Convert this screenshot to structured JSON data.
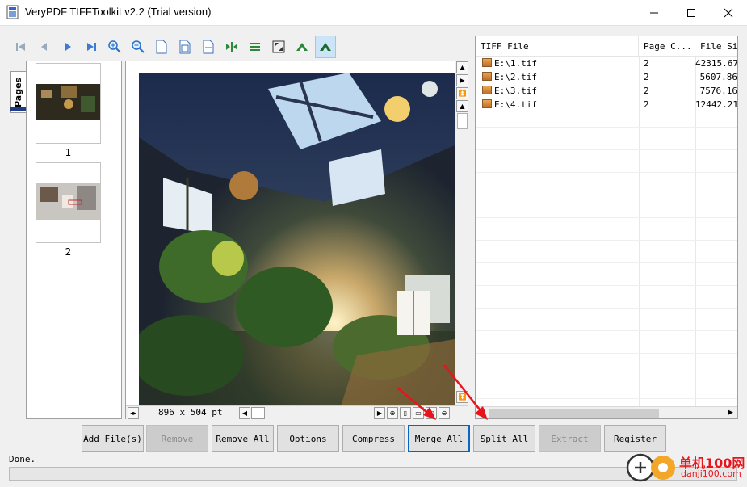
{
  "window": {
    "title": "VeryPDF TIFFToolkit v2.2 (Trial version)",
    "minimize": "—",
    "maximize": "☐",
    "close": "✕"
  },
  "toolbar": {
    "icons": [
      "first-page-icon",
      "previous-page-icon",
      "next-page-icon",
      "last-page-icon",
      "zoom-in-icon",
      "zoom-out-icon",
      "page-icon",
      "fit-page-icon",
      "fit-width-icon",
      "rotate-icon",
      "split-view-icon",
      "fit-window-icon",
      "rotate-left-icon",
      "rotate-right-icon"
    ]
  },
  "sidebar": {
    "tab_label": "Pages",
    "thumbnails": [
      {
        "label": "1"
      },
      {
        "label": "2"
      }
    ]
  },
  "viewer": {
    "dimensions": "896 x 504 pt"
  },
  "file_list": {
    "columns": [
      "TIFF File",
      "Page C...",
      "File Siz"
    ],
    "rows": [
      {
        "file": "E:\\1.tif",
        "pages": "2",
        "size": "42315.67"
      },
      {
        "file": "E:\\2.tif",
        "pages": "2",
        "size": "5607.86"
      },
      {
        "file": "E:\\3.tif",
        "pages": "2",
        "size": "7576.16"
      },
      {
        "file": "E:\\4.tif",
        "pages": "2",
        "size": "12442.21"
      }
    ]
  },
  "buttons": {
    "add_files": "Add File(s)",
    "remove": "Remove",
    "remove_all": "Remove All",
    "options": "Options",
    "compress": "Compress",
    "merge_all": "Merge All",
    "split_all": "Split All",
    "extract": "Extract",
    "register": "Register"
  },
  "status": {
    "text": "Done."
  },
  "watermark": {
    "site_cn": "单机100网",
    "site_url": "danji100.com"
  },
  "colors": {
    "accent": "#0a64c0",
    "arrow": "#e8141c"
  }
}
